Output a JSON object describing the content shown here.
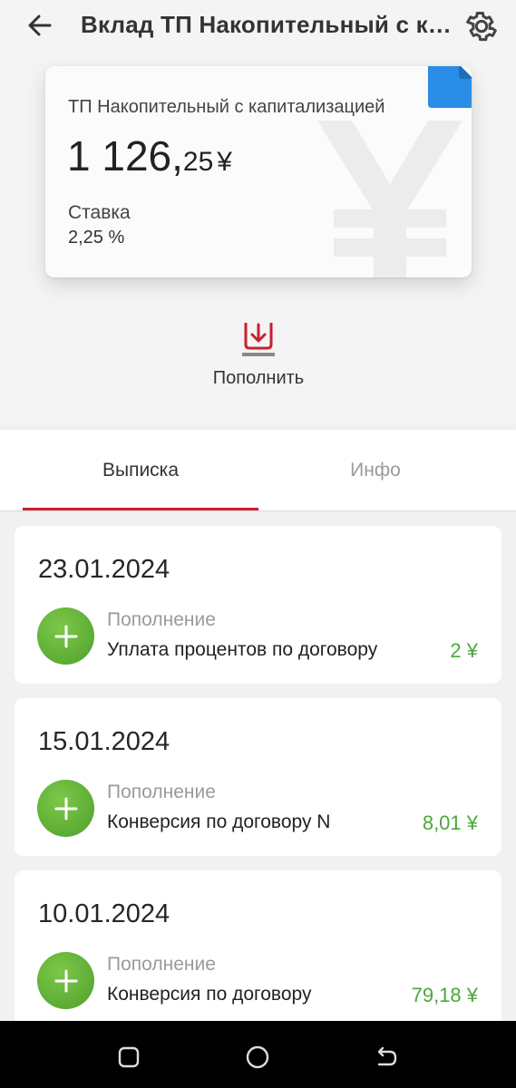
{
  "header": {
    "title": "Вклад ТП Накопительный с капитализацией",
    "back_icon": "arrow-left-icon",
    "settings_icon": "gear-icon"
  },
  "card": {
    "name": "ТП Накопительный с капитализацией",
    "amount_int": "1 126,",
    "amount_frac": "25",
    "currency": "¥",
    "rate_label": "Ставка",
    "rate_value": "2,25 %",
    "accent_color": "#2a8de6"
  },
  "action": {
    "label": "Пополнить",
    "icon": "deposit-arrow-icon",
    "color": "#c8202f"
  },
  "tabs": [
    {
      "label": "Выписка",
      "active": true
    },
    {
      "label": "Инфо",
      "active": false
    }
  ],
  "transactions": [
    {
      "date": "23.01.2024",
      "type": "Пополнение",
      "description": "Уплата процентов по договору",
      "amount": "2 ¥"
    },
    {
      "date": "15.01.2024",
      "type": "Пополнение",
      "description": "Конверсия по договору N",
      "amount": "8,01 ¥"
    },
    {
      "date": "10.01.2024",
      "type": "Пополнение",
      "description": "Конверсия по договору",
      "amount": "79,18 ¥"
    }
  ],
  "navbar": {
    "icons": [
      "recent-apps-icon",
      "home-icon",
      "back-icon"
    ]
  }
}
